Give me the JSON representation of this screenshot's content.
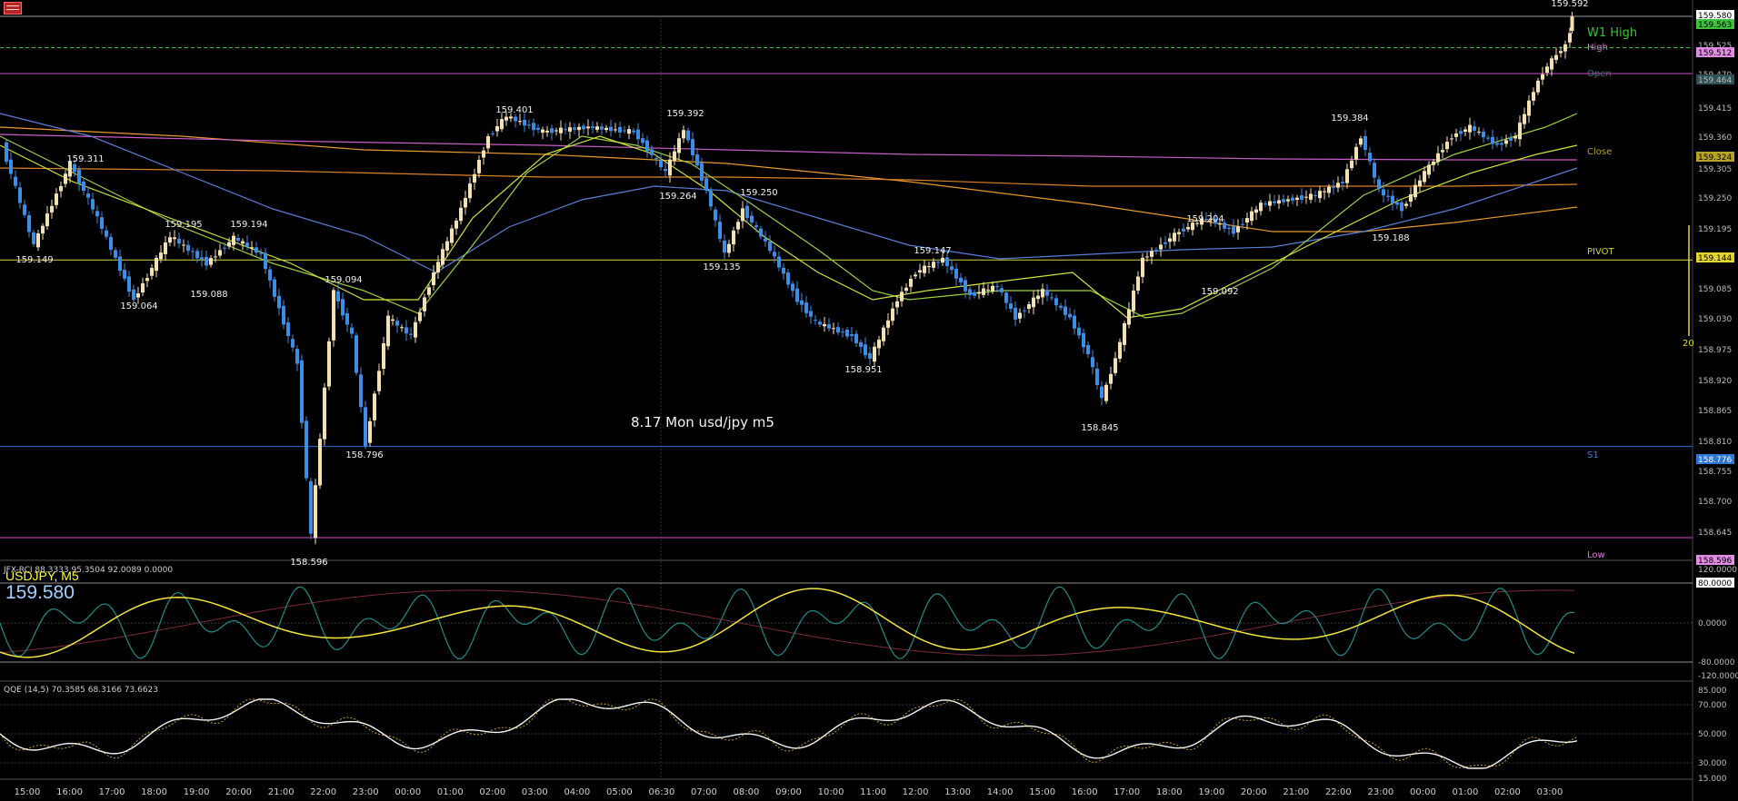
{
  "window": {
    "annotation": "8.17 Mon usd/jpy m5",
    "symbol": "USDJPY, M5",
    "last_price": "159.580"
  },
  "colors": {
    "background": "#000000",
    "bull_candle": "#f3e2b0",
    "bear_candle": "#3b8ee8",
    "pivot_line": "#d8d23a",
    "high_line": "#d14fd1",
    "s1_line": "#2a6fd4",
    "w1_high": "#34c334"
  },
  "price_axis": {
    "ticks": [
      "159.580",
      "159.563",
      "159.525",
      "159.512",
      "159.470",
      "159.464",
      "159.415",
      "159.360",
      "159.324",
      "159.305",
      "159.250",
      "159.195",
      "159.144",
      "159.085",
      "159.030",
      "158.975",
      "158.920",
      "158.865",
      "158.810",
      "158.776",
      "158.755",
      "158.700",
      "158.645",
      "158.596"
    ],
    "scale_label": "20"
  },
  "level_labels": {
    "w1_high": "W1 High",
    "high": "High",
    "open": "Open",
    "close": "Close",
    "pivot": "PIVOT",
    "s1": "S1",
    "low": "Low"
  },
  "price_labels": [
    "159.592",
    "159.401",
    "159.392",
    "159.384",
    "159.311",
    "159.264",
    "159.250",
    "159.204",
    "159.195",
    "159.194",
    "159.188",
    "159.149",
    "159.147",
    "159.135",
    "159.094",
    "159.092",
    "159.088",
    "159.064",
    "158.951",
    "158.845",
    "158.796",
    "158.596"
  ],
  "time_axis": [
    "15:00",
    "16:00",
    "17:00",
    "18:00",
    "19:00",
    "20:00",
    "21:00",
    "22:00",
    "23:00",
    "00:00",
    "01:00",
    "02:00",
    "03:00",
    "04:00",
    "05:00",
    "06:30",
    "07:00",
    "08:00",
    "09:00",
    "10:00",
    "11:00",
    "12:00",
    "13:00",
    "14:00",
    "15:00",
    "16:00",
    "17:00",
    "18:00",
    "19:00",
    "20:00",
    "21:00",
    "22:00",
    "23:00",
    "00:00",
    "01:00",
    "02:00",
    "03:00"
  ],
  "rci_panel": {
    "title": "JFX-RCI 88.3333 95.3504 92.0089 0.0000",
    "levels": [
      "120.0000",
      "80.0000",
      "0.0000",
      "-80.0000",
      "-120.0000"
    ]
  },
  "qqe_panel": {
    "title": "QQE (14,5) 70.3585 68.3166 73.6623",
    "levels": [
      "85.000",
      "70.000",
      "50.000",
      "30.000",
      "15.000"
    ]
  }
}
